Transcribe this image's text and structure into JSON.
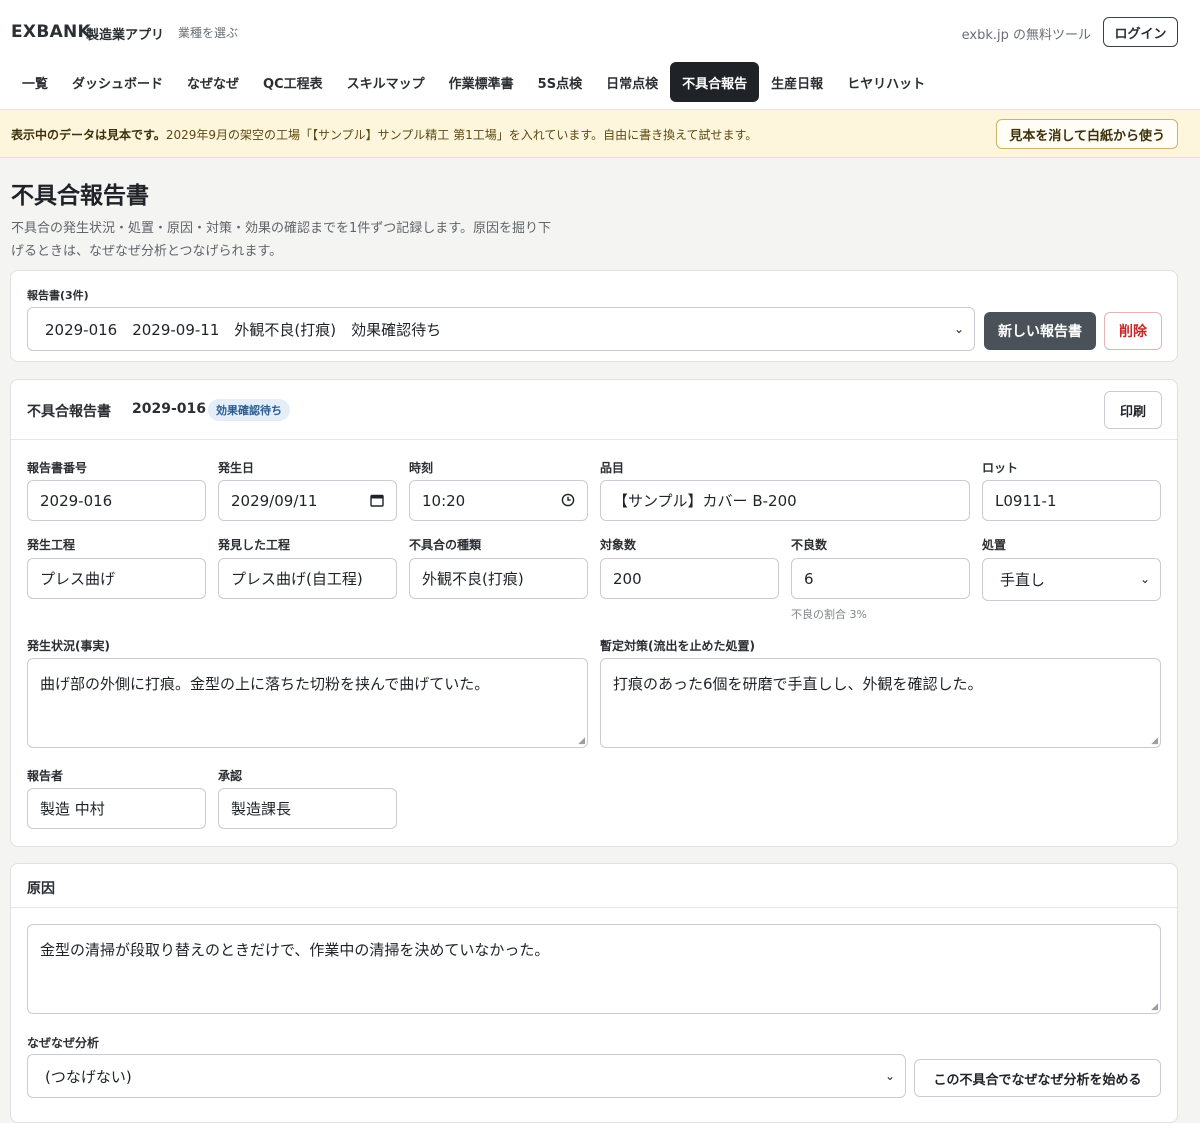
{
  "header": {
    "logo": "EXBANK",
    "app_name": "製造業アプリ",
    "industry_link": "業種を選ぶ",
    "free_tools": "exbk.jp の無料ツール",
    "login": "ログイン"
  },
  "nav": {
    "items": [
      "一覧",
      "ダッシュボード",
      "なぜなぜ",
      "QC工程表",
      "スキルマップ",
      "作業標準書",
      "5S点検",
      "日常点検",
      "不具合報告",
      "生産日報",
      "ヒヤリハット"
    ],
    "active_index": 8
  },
  "banner": {
    "bold": "表示中のデータは見本です。",
    "text": "2029年9月の架空の工場「【サンプル】サンプル精工 第1工場」を入れています。自由に書き換えて試せます。",
    "button": "見本を消して白紙から使う"
  },
  "page": {
    "title": "不具合報告書",
    "description": "不具合の発生状況・処置・原因・対策・効果の確認までを1件ずつ記録します。原因を掘り下げるときは、なぜなぜ分析とつなげられます。"
  },
  "report_selector": {
    "label": "報告書(3件)",
    "selected": "2029-016　2029-09-11　外観不良(打痕)　効果確認待ち",
    "new_button": "新しい報告書",
    "delete_button": "削除"
  },
  "report": {
    "header_title": "不具合報告書",
    "header_number": "2029-016",
    "status_badge": "効果確認待ち",
    "print_button": "印刷",
    "fields": {
      "report_no": {
        "label": "報告書番号",
        "value": "2029-016"
      },
      "date": {
        "label": "発生日",
        "value": "2029/09/11"
      },
      "time": {
        "label": "時刻",
        "value": "10:20"
      },
      "item": {
        "label": "品目",
        "value": "【サンプル】カバー B-200"
      },
      "lot": {
        "label": "ロット",
        "value": "L0911-1"
      },
      "process": {
        "label": "発生工程",
        "value": "プレス曲げ"
      },
      "found_process": {
        "label": "発見した工程",
        "value": "プレス曲げ(自工程)"
      },
      "defect_type": {
        "label": "不具合の種類",
        "value": "外観不良(打痕)"
      },
      "target_count": {
        "label": "対象数",
        "value": "200"
      },
      "defect_count": {
        "label": "不良数",
        "value": "6",
        "hint": "不良の割合 3%"
      },
      "disposition": {
        "label": "処置",
        "value": "手直し"
      },
      "situation": {
        "label": "発生状況(事実)",
        "value": "曲げ部の外側に打痕。金型の上に落ちた切粉を挟んで曲げていた。"
      },
      "interim": {
        "label": "暫定対策(流出を止めた処置)",
        "value": "打痕のあった6個を研磨で手直しし、外観を確認した。"
      },
      "reporter": {
        "label": "報告者",
        "value": "製造 中村"
      },
      "approver": {
        "label": "承認",
        "value": "製造課長"
      }
    }
  },
  "cause": {
    "title": "原因",
    "value": "金型の清掃が段取り替えのときだけで、作業中の清掃を決めていなかった。",
    "why_label": "なぜなぜ分析",
    "why_selected": "(つなげない)",
    "why_button": "この不具合でなぜなぜ分析を始める"
  },
  "icons": {
    "calendar": "calendar-icon",
    "clock": "clock-icon",
    "chevron": "chevron-down-icon"
  }
}
